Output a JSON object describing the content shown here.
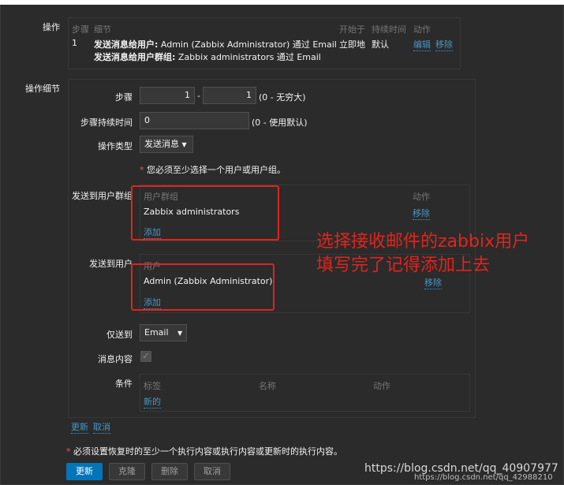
{
  "operations": {
    "label": "操作",
    "headers": {
      "step": "步骤",
      "details": "细节",
      "start_in": "开始于",
      "duration": "持续时间",
      "action": "动作"
    },
    "row": {
      "step": "1",
      "detail1_bold": "发送消息给用户:",
      "detail1_rest": " Admin (Zabbix Administrator) 通过 Email",
      "detail2_bold": "发送消息给用户群组:",
      "detail2_rest": " Zabbix administrators 通过 Email",
      "start_in": "立即地",
      "duration": "默认",
      "edit_label": "编辑",
      "remove_label": "移除"
    }
  },
  "details": {
    "label": "操作细节",
    "steps": {
      "label": "步骤",
      "from": "1",
      "sep": "-",
      "to": "1",
      "hint": "(0 - 无穷大)"
    },
    "step_duration": {
      "label": "步骤持续时间",
      "value": "0",
      "hint": "(0 - 使用默认)"
    },
    "op_type": {
      "label": "操作类型",
      "value": "发送消息",
      "arrow": "▼"
    },
    "required_note": "您必须至少选择一个用户或用户组。",
    "send_to_groups": {
      "label": "发送到用户群组",
      "col_group": "用户群组",
      "col_action": "动作",
      "items": [
        {
          "name": "Zabbix administrators",
          "remove": "移除"
        }
      ],
      "add_label": "添加"
    },
    "send_to_users": {
      "label": "发送到用户",
      "col_user": "用户",
      "col_action": "动作",
      "items": [
        {
          "name": "Admin (Zabbix Administrator)",
          "remove": "移除"
        }
      ],
      "add_label": "添加"
    },
    "send_only_to": {
      "label": "仅送到",
      "value": "Email",
      "arrow": "▼"
    },
    "default_message": {
      "label": "消息内容",
      "checked": true,
      "mark": "✓"
    },
    "conditions": {
      "label": "条件",
      "col_label": "标签",
      "col_name": "名称",
      "col_action": "动作",
      "new_label": "新的"
    },
    "update_link": "更新",
    "cancel_link": "取消"
  },
  "footer_note": "必须设置恢复时的至少一个执行内容或执行内容或更新时的执行内容。",
  "buttons": {
    "update": "更新",
    "clone": "克隆",
    "delete": "删除",
    "cancel": "取消"
  },
  "annotation": {
    "line1": "选择接收邮件的zabbix用户",
    "line2": "填写完了记得添加上去",
    "color": "#e0241c"
  },
  "watermark": {
    "main": "https://blog.csdn.net/qq_40907977",
    "sub": "https://blog.csdn.net/qq_42988210"
  }
}
